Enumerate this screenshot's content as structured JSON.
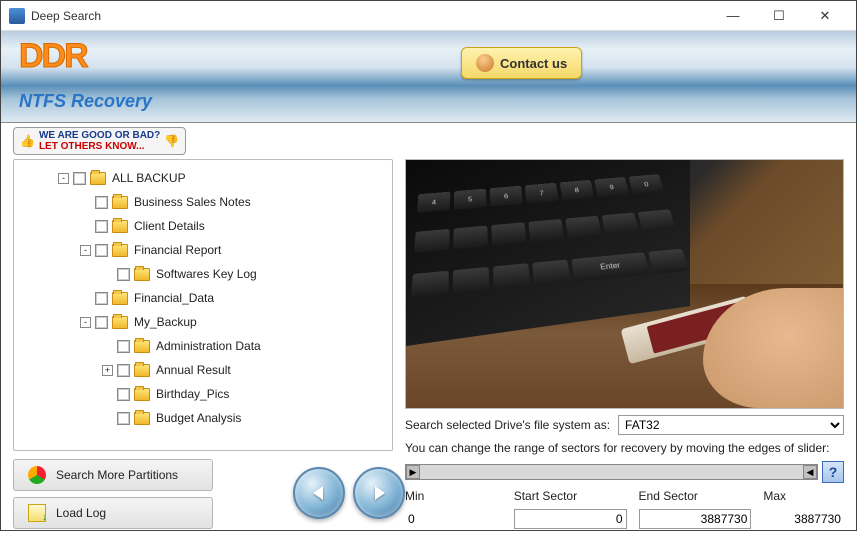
{
  "window": {
    "title": "Deep Search"
  },
  "banner": {
    "logo": "DDR",
    "subtitle": "NTFS Recovery",
    "contact_label": "Contact us"
  },
  "feedback": {
    "line1": "WE ARE GOOD OR BAD?",
    "line2": "LET OTHERS KNOW..."
  },
  "tree": {
    "nodes": [
      {
        "label": "ALL BACKUP",
        "indent": 1,
        "expander": "-"
      },
      {
        "label": "Business Sales Notes",
        "indent": 2,
        "expander": ""
      },
      {
        "label": "Client Details",
        "indent": 2,
        "expander": ""
      },
      {
        "label": "Financial Report",
        "indent": 2,
        "expander": "-"
      },
      {
        "label": "Softwares Key Log",
        "indent": 3,
        "expander": ""
      },
      {
        "label": "Financial_Data",
        "indent": 2,
        "expander": ""
      },
      {
        "label": "My_Backup",
        "indent": 2,
        "expander": "-"
      },
      {
        "label": "Administration Data",
        "indent": 3,
        "expander": ""
      },
      {
        "label": "Annual Result",
        "indent": 3,
        "expander": "+"
      },
      {
        "label": "Birthday_Pics",
        "indent": 3,
        "expander": ""
      },
      {
        "label": "Budget Analysis",
        "indent": 3,
        "expander": ""
      }
    ]
  },
  "buttons": {
    "search_more": "Search More Partitions",
    "load_log": "Load Log"
  },
  "fs": {
    "label": "Search selected Drive's file system as:",
    "selected": "FAT32"
  },
  "slider": {
    "info": "You can change the range of sectors for recovery by moving the edges of slider:",
    "help": "?"
  },
  "sectors": {
    "min_label": "Min",
    "min_value": "0",
    "start_label": "Start Sector",
    "start_value": "0",
    "end_label": "End Sector",
    "end_value": "3887730",
    "max_label": "Max",
    "max_value": "3887730"
  }
}
